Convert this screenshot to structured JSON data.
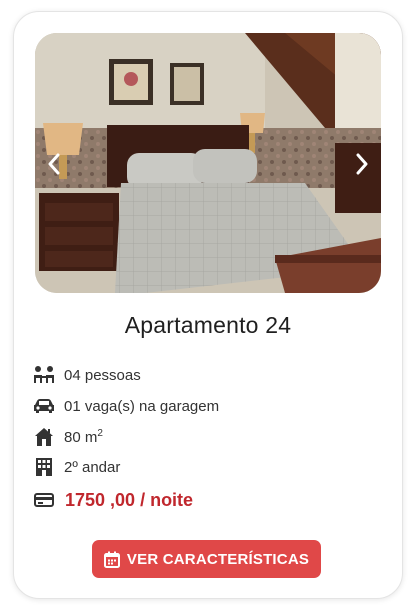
{
  "listing": {
    "title": "Apartamento 24",
    "features": {
      "guests": "04 pessoas",
      "parking": "01 vaga(s) na garagem",
      "area_value": "80 m",
      "area_unit_sup": "2",
      "floor": "2º andar",
      "price": "1750 ,00 / noite"
    },
    "button_label": "VER CARACTERÍSTICAS"
  },
  "icons": {
    "prev": "chevron-left-icon",
    "next": "chevron-right-icon",
    "guests": "people-icon",
    "parking": "car-icon",
    "area": "house-icon",
    "floor": "building-icon",
    "price": "credit-card-icon",
    "button": "calendar-icon"
  },
  "colors": {
    "accent": "#e04848",
    "price": "#c0272d",
    "icon": "#333333"
  }
}
